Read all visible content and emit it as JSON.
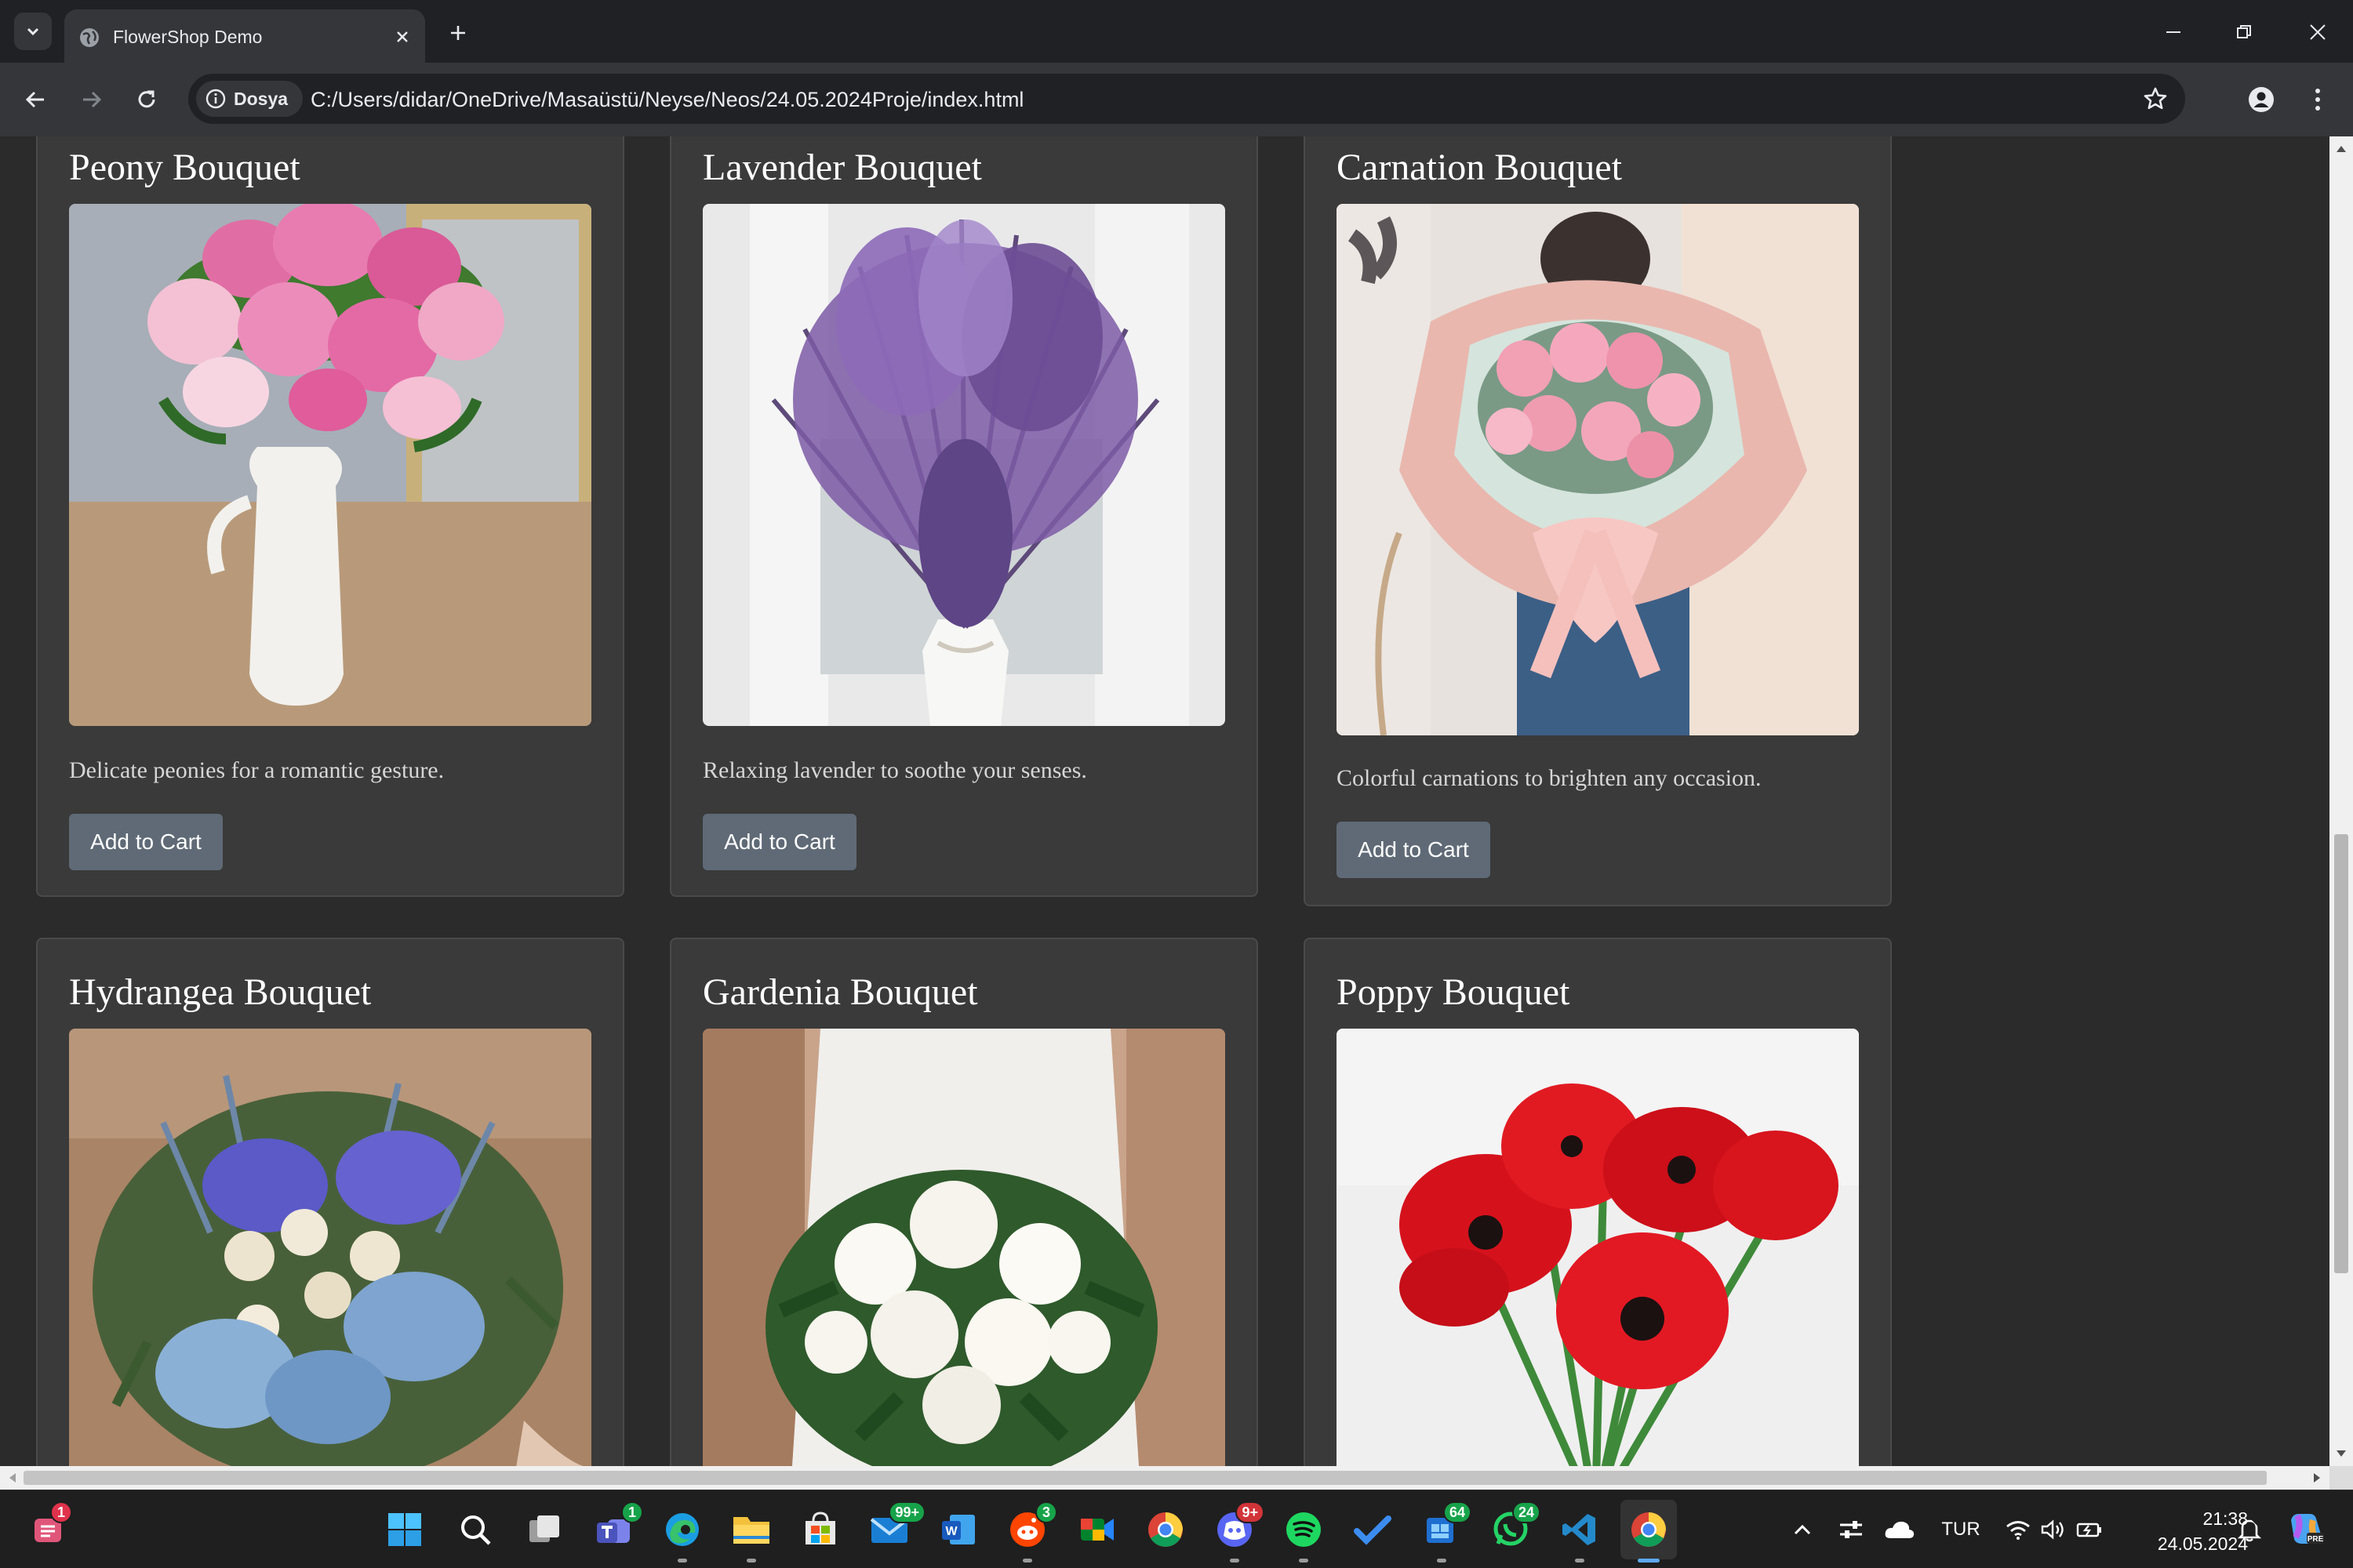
{
  "browser": {
    "tab_title": "FlowerShop Demo",
    "site_chip_label": "Dosya",
    "url": "C:/Users/didar/OneDrive/Masaüstü/Neyse/Neos/24.05.2024Proje/index.html"
  },
  "products": [
    {
      "name": "Peony Bouquet",
      "description": "Delicate peonies for a romantic gesture.",
      "button": "Add to Cart",
      "image_icon": "peony-photo"
    },
    {
      "name": "Lavender Bouquet",
      "description": "Relaxing lavender to soothe your senses.",
      "button": "Add to Cart",
      "image_icon": "lavender-photo"
    },
    {
      "name": "Carnation Bouquet",
      "description": "Colorful carnations to brighten any occasion.",
      "button": "Add to Cart",
      "image_icon": "carnation-photo"
    },
    {
      "name": "Hydrangea Bouquet",
      "image_icon": "hydrangea-photo"
    },
    {
      "name": "Gardenia Bouquet",
      "image_icon": "gardenia-photo"
    },
    {
      "name": "Poppy Bouquet",
      "image_icon": "poppy-photo"
    }
  ],
  "taskbar": {
    "badges": {
      "notifications": "1",
      "teams": "1",
      "mail": "99+",
      "reddit": "3",
      "discord": "9+",
      "store": "64",
      "whatsapp": "24"
    },
    "language": "TUR",
    "time": "21:38",
    "date": "24.05.2024"
  },
  "colors": {
    "page_bg": "#2b2b2b",
    "card_bg": "#3a3a3a",
    "button_bg": "#5f6a76",
    "chrome_dark": "#202124",
    "chrome_toolbar": "#35363a"
  }
}
